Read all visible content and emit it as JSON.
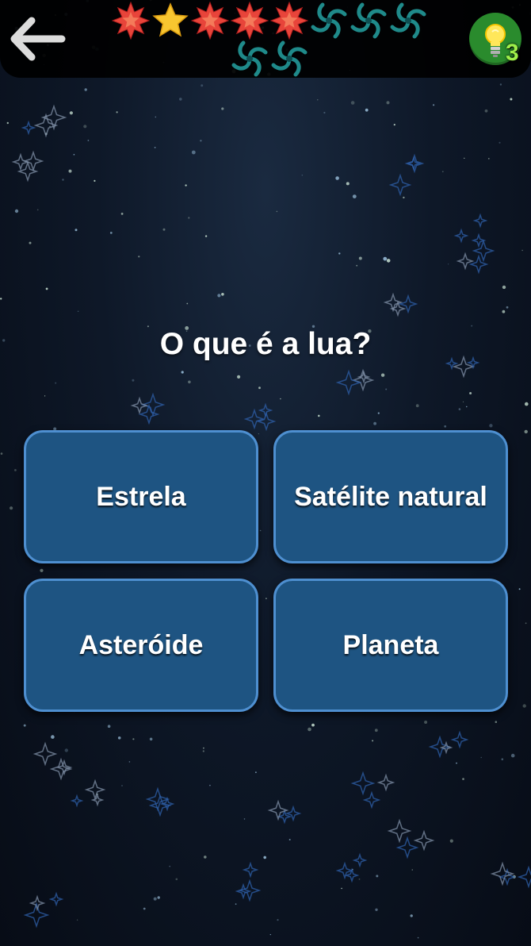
{
  "header": {
    "back_icon": "arrow-left-icon",
    "progress": [
      {
        "state": "wrong",
        "icon": "red-star-icon",
        "color": "#e8443a"
      },
      {
        "state": "correct",
        "icon": "gold-star-icon",
        "color": "#f8c630"
      },
      {
        "state": "wrong",
        "icon": "red-star-icon",
        "color": "#e8443a"
      },
      {
        "state": "wrong",
        "icon": "red-star-icon",
        "color": "#e8443a"
      },
      {
        "state": "wrong",
        "icon": "red-star-icon",
        "color": "#e8443a"
      },
      {
        "state": "pending",
        "icon": "spiral-galaxy-icon",
        "color": "#1f8a8a"
      },
      {
        "state": "pending",
        "icon": "spiral-galaxy-icon",
        "color": "#1f8a8a"
      },
      {
        "state": "pending",
        "icon": "spiral-galaxy-icon",
        "color": "#1f8a8a"
      },
      {
        "state": "pending",
        "icon": "spiral-galaxy-icon",
        "color": "#1f8a8a"
      },
      {
        "state": "pending",
        "icon": "spiral-galaxy-icon",
        "color": "#1f8a8a"
      }
    ],
    "hint": {
      "icon": "lightbulb-icon",
      "count": "3",
      "color": "#2a8b2d"
    }
  },
  "question": "O que é a lua?",
  "answers": [
    {
      "label": "Estrela"
    },
    {
      "label": "Satélite natural"
    },
    {
      "label": "Asteróide"
    },
    {
      "label": "Planeta"
    }
  ],
  "colors": {
    "answer_fill": "#1e5482",
    "answer_border": "#4e8fd0",
    "background": "#0c1422"
  }
}
